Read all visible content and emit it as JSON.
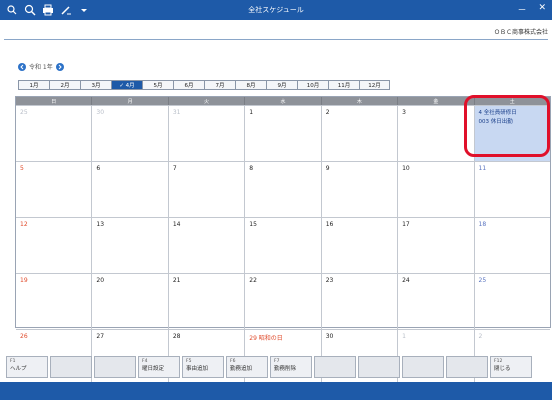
{
  "titlebar": {
    "title": "全社スケジュール",
    "minimize": "－",
    "close": "✕"
  },
  "company_label": "ＯＢＣ商事株式会社",
  "year_label": "令和 1年",
  "months": [
    {
      "label": "1月",
      "selected": false
    },
    {
      "label": "2月",
      "selected": false
    },
    {
      "label": "3月",
      "selected": false
    },
    {
      "label": "✓ 4月",
      "selected": true
    },
    {
      "label": "5月",
      "selected": false
    },
    {
      "label": "6月",
      "selected": false
    },
    {
      "label": "7月",
      "selected": false
    },
    {
      "label": "8月",
      "selected": false
    },
    {
      "label": "9月",
      "selected": false
    },
    {
      "label": "10月",
      "selected": false
    },
    {
      "label": "11月",
      "selected": false
    },
    {
      "label": "12月",
      "selected": false
    }
  ],
  "weekdays": [
    "日",
    "月",
    "火",
    "水",
    "木",
    "金",
    "土"
  ],
  "weeks": [
    [
      {
        "d": "25",
        "cls": "other"
      },
      {
        "d": "30",
        "cls": "other"
      },
      {
        "d": "31",
        "cls": "other"
      },
      {
        "d": "1",
        "cls": ""
      },
      {
        "d": "2",
        "cls": ""
      },
      {
        "d": "3",
        "cls": ""
      },
      {
        "d": "",
        "cls": "event"
      }
    ],
    [
      {
        "d": "5",
        "cls": "sun"
      },
      {
        "d": "6",
        "cls": ""
      },
      {
        "d": "7",
        "cls": ""
      },
      {
        "d": "8",
        "cls": ""
      },
      {
        "d": "9",
        "cls": ""
      },
      {
        "d": "10",
        "cls": ""
      },
      {
        "d": "11",
        "cls": "sat"
      }
    ],
    [
      {
        "d": "12",
        "cls": "sun"
      },
      {
        "d": "13",
        "cls": ""
      },
      {
        "d": "14",
        "cls": ""
      },
      {
        "d": "15",
        "cls": ""
      },
      {
        "d": "16",
        "cls": ""
      },
      {
        "d": "17",
        "cls": ""
      },
      {
        "d": "18",
        "cls": "sat"
      }
    ],
    [
      {
        "d": "19",
        "cls": "sun"
      },
      {
        "d": "20",
        "cls": ""
      },
      {
        "d": "21",
        "cls": ""
      },
      {
        "d": "22",
        "cls": ""
      },
      {
        "d": "23",
        "cls": ""
      },
      {
        "d": "24",
        "cls": ""
      },
      {
        "d": "25",
        "cls": "sat"
      }
    ],
    [
      {
        "d": "26",
        "cls": "sun"
      },
      {
        "d": "27",
        "cls": ""
      },
      {
        "d": "28",
        "cls": ""
      },
      {
        "d": "29 昭和の日",
        "cls": "holiday"
      },
      {
        "d": "30",
        "cls": ""
      },
      {
        "d": "1",
        "cls": "other"
      },
      {
        "d": "2",
        "cls": "other"
      }
    ]
  ],
  "event": {
    "line1": "4  全社員研修日",
    "line2": "003    休日出勤"
  },
  "fkeys": [
    {
      "fn": "F1",
      "label": "ヘルプ"
    },
    {
      "fn": "",
      "label": ""
    },
    {
      "fn": "",
      "label": ""
    },
    {
      "fn": "F4",
      "label": "曜日設定"
    },
    {
      "fn": "F5",
      "label": "事由追加"
    },
    {
      "fn": "F6",
      "label": "勤務追加"
    },
    {
      "fn": "F7",
      "label": "勤務削除"
    },
    {
      "fn": "",
      "label": ""
    },
    {
      "fn": "",
      "label": ""
    },
    {
      "fn": "",
      "label": ""
    },
    {
      "fn": "",
      "label": ""
    },
    {
      "fn": "F12",
      "label": "閉じる"
    }
  ]
}
